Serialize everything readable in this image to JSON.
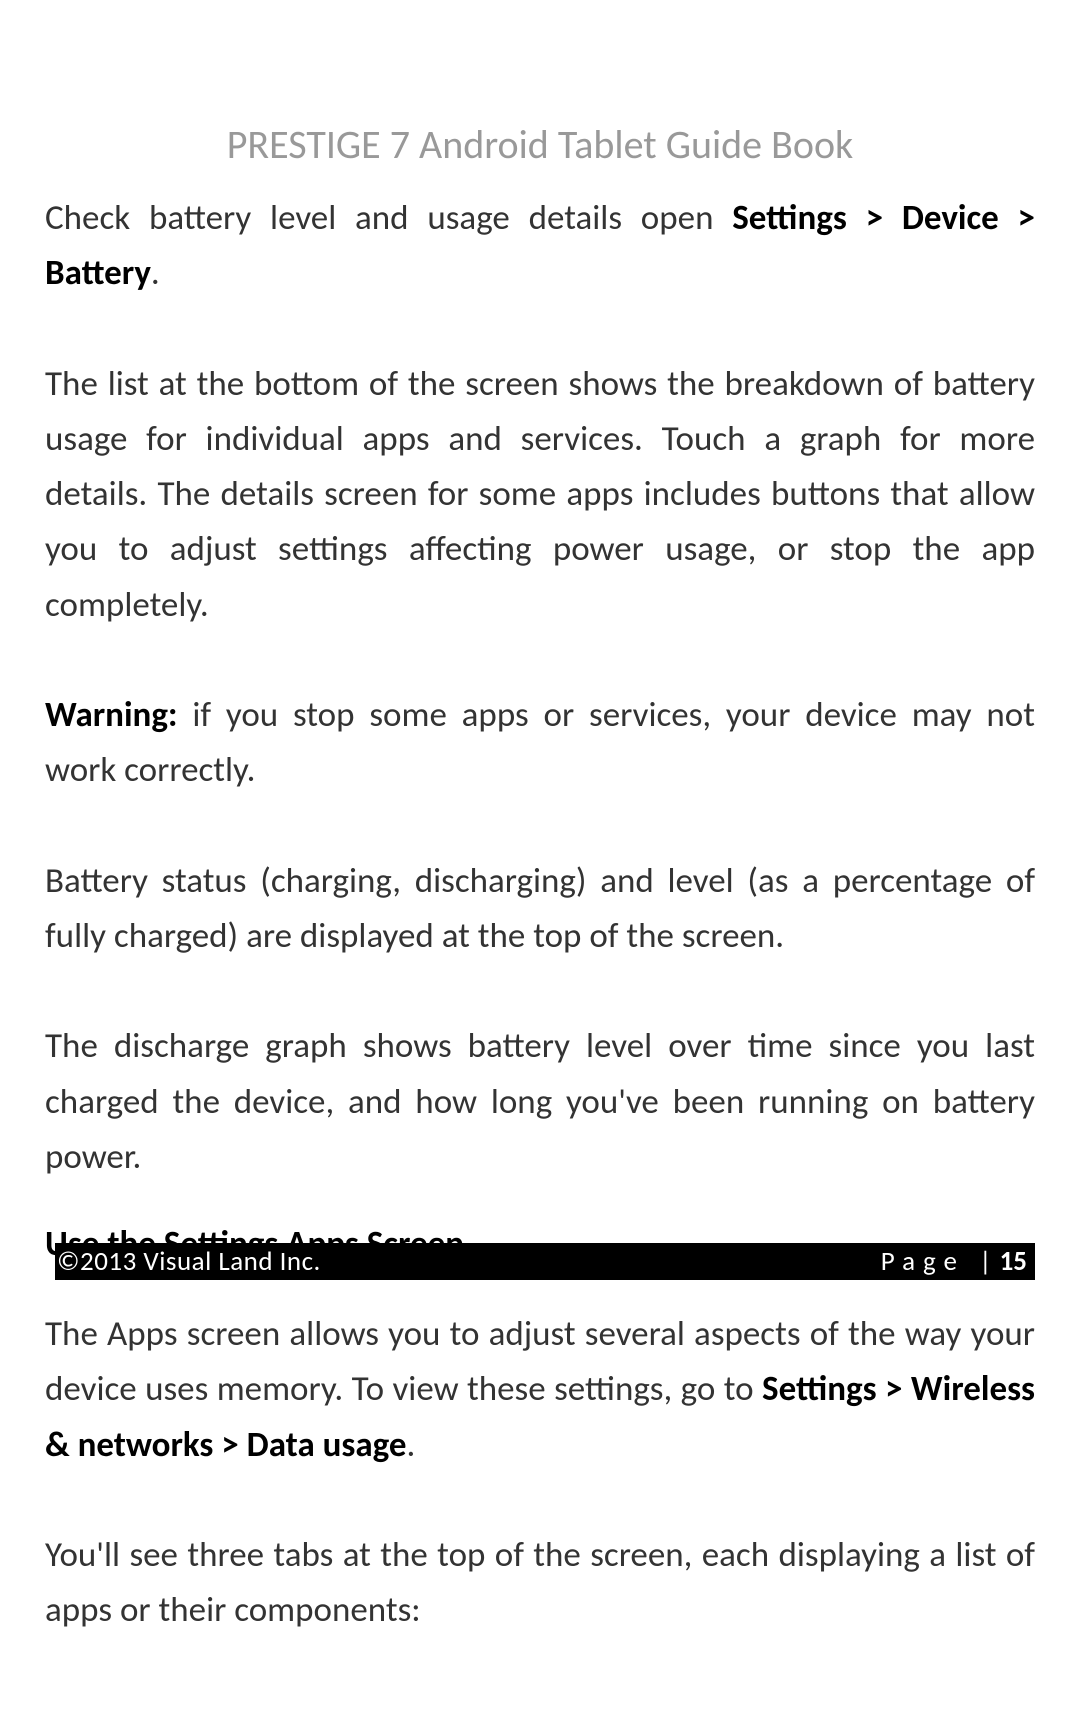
{
  "header": {
    "title": "PRESTIGE 7 Android Tablet Guide Book"
  },
  "content": {
    "p1_lead": "Check battery level and usage details open ",
    "p1_bold": "Settings > Device > Battery",
    "p1_tail": ".",
    "p2": "The list at the bottom of the screen shows the breakdown of battery usage for individual apps and services. Touch a graph for more details. The details screen for some apps includes buttons that allow you to adjust settings affecting power usage, or stop the app completely.",
    "p3_bold": "Warning:",
    "p3_tail": " if you stop some apps or services, your device may not work correctly.",
    "p4": "Battery status (charging, discharging) and level (as a percentage of fully charged) are displayed at the top of the screen.",
    "p5": "The discharge graph shows battery level over time since you last charged the device, and how long you've been running on battery power.",
    "heading1": "Use the Settings Apps Screen",
    "p6_lead": "The Apps screen allows you to adjust several aspects of the way your device uses memory. To view these settings, go to ",
    "p6_bold": "Settings > Wireless & networks > Data usage",
    "p6_tail": ".",
    "p7": "You'll see three tabs at the top of the screen, each displaying a list of apps or their components:"
  },
  "footer": {
    "copyright": "©2013 Visual Land Inc.",
    "page_label": "Page ",
    "page_pipe": "| ",
    "page_number": "15"
  }
}
